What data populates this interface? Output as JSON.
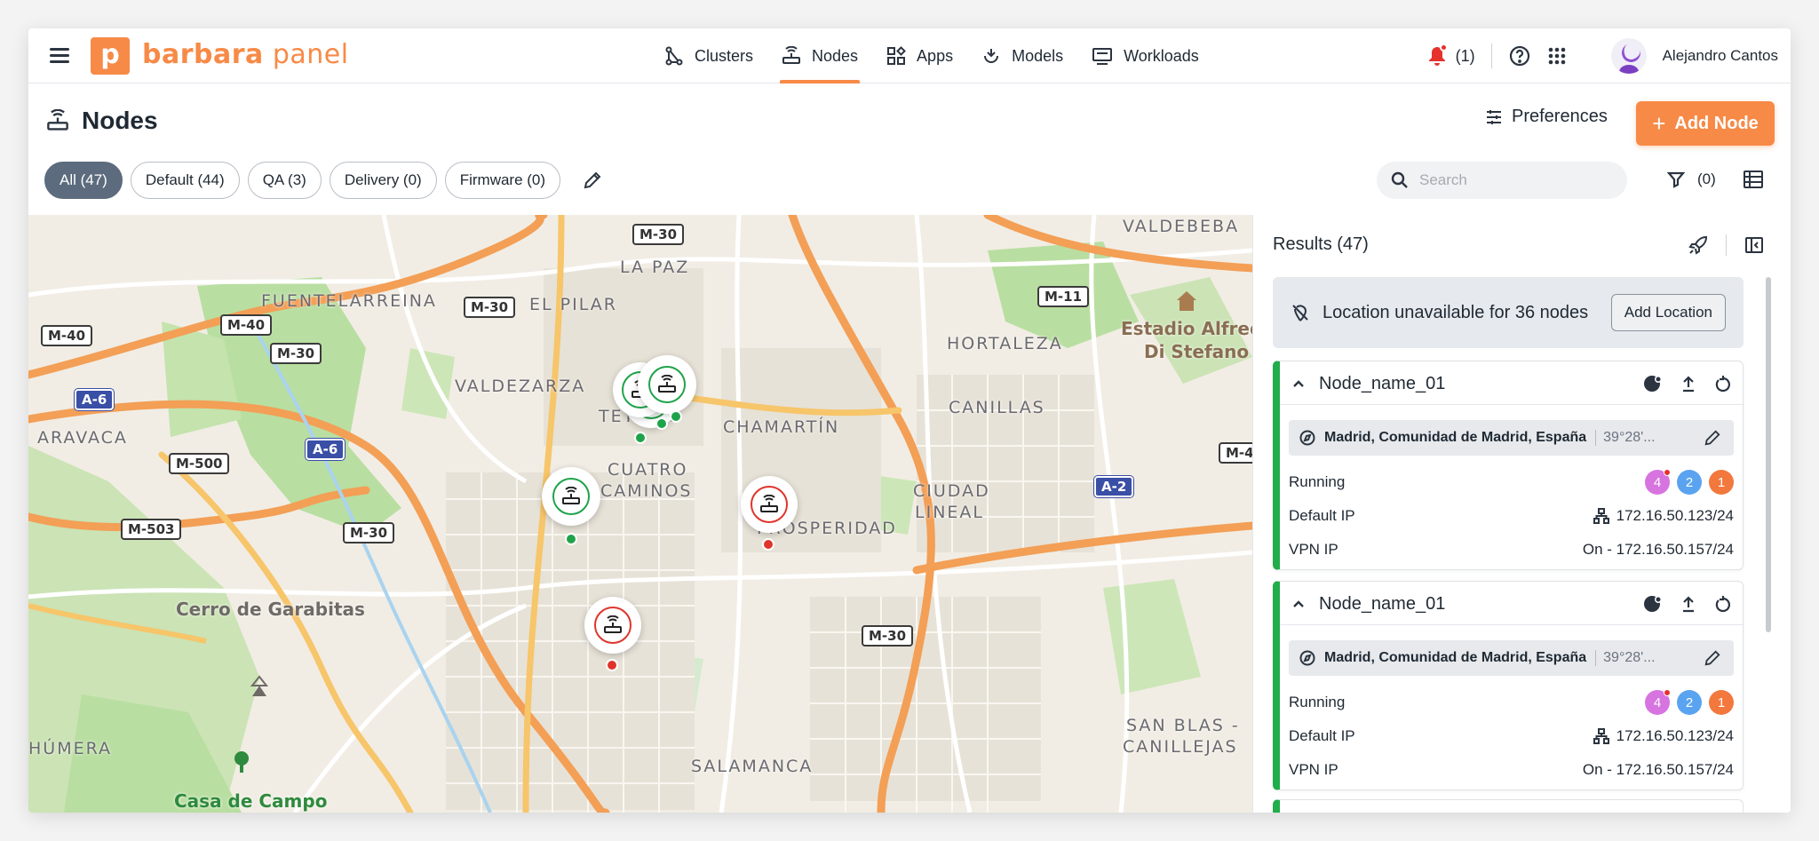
{
  "app": {
    "logo_letter": "p",
    "logo_brand": "barbara",
    "logo_suffix": "panel",
    "brand_color": "#f78a47"
  },
  "nav": [
    {
      "label": "Clusters",
      "icon": "clusters-icon"
    },
    {
      "label": "Nodes",
      "icon": "router-icon",
      "active": true
    },
    {
      "label": "Apps",
      "icon": "apps-icon"
    },
    {
      "label": "Models",
      "icon": "models-icon"
    },
    {
      "label": "Workloads",
      "icon": "workloads-icon"
    }
  ],
  "topbar": {
    "notifications": "(1)",
    "user_name": "Alejandro Cantos"
  },
  "page": {
    "title": "Nodes",
    "preferences_label": "Preferences",
    "add_label": "Add Node"
  },
  "filters": {
    "chips": [
      "All (47)",
      "Default (44)",
      "QA (3)",
      "Delivery (0)",
      "Firmware (0)"
    ],
    "active": 0,
    "search_placeholder": "Search",
    "filter_count": "(0)"
  },
  "map": {
    "labels": [
      "VALDEBEBA",
      "LA PAZ",
      "FUENTELARREINA",
      "EL PILAR",
      "HORTALEZA",
      "VALDEZARZA",
      "TETUÁN",
      "CHAMARTÍN",
      "CANILLAS",
      "ARAVACA",
      "CUATRO",
      "CAMINOS",
      "CIUDAD",
      "LINEAL",
      "PROSPERIDAD",
      "SALAMANCA",
      "SAN BLAS -",
      "CANILLEJAS",
      "HÚMERA"
    ],
    "roads": [
      "M-30",
      "M-11",
      "M-40",
      "M-30",
      "M-40",
      "M-30",
      "A-6",
      "A-6",
      "M-500",
      "M-503",
      "M-30",
      "M-30",
      "A-2",
      "M-4"
    ],
    "places": [
      "Estadio Alfredo",
      "Di Stefano",
      "Cerro de Garabitas",
      "Casa de Campo"
    ],
    "markers": [
      {
        "status": "online"
      },
      {
        "status": "online"
      },
      {
        "status": "online"
      },
      {
        "status": "online"
      },
      {
        "status": "offline"
      },
      {
        "status": "offline"
      }
    ]
  },
  "results": {
    "title": "Results (47)",
    "alert_text": "Location unavailable for 36 nodes",
    "alert_button": "Add Location",
    "cards": [
      {
        "name": "Node_name_01",
        "location": "Madrid, Comunidad de Madrid, España",
        "coords": "39°28'...",
        "status": "Running",
        "badges": [
          "4",
          "2",
          "1"
        ],
        "default_ip_label": "Default IP",
        "default_ip": "172.16.50.123/24",
        "vpn_label": "VPN IP",
        "vpn_ip": "On - 172.16.50.157/24"
      },
      {
        "name": "Node_name_01",
        "location": "Madrid, Comunidad de Madrid, España",
        "coords": "39°28'...",
        "status": "Running",
        "badges": [
          "4",
          "2",
          "1"
        ],
        "default_ip_label": "Default IP",
        "default_ip": "172.16.50.123/24",
        "vpn_label": "VPN IP",
        "vpn_ip": "On - 172.16.50.157/24"
      }
    ]
  },
  "colors": {
    "online": "#1fa34a",
    "offline": "#e0342b",
    "badge_purple": "#d774e0",
    "badge_blue": "#5aa3f0",
    "badge_orange": "#f2783d"
  }
}
